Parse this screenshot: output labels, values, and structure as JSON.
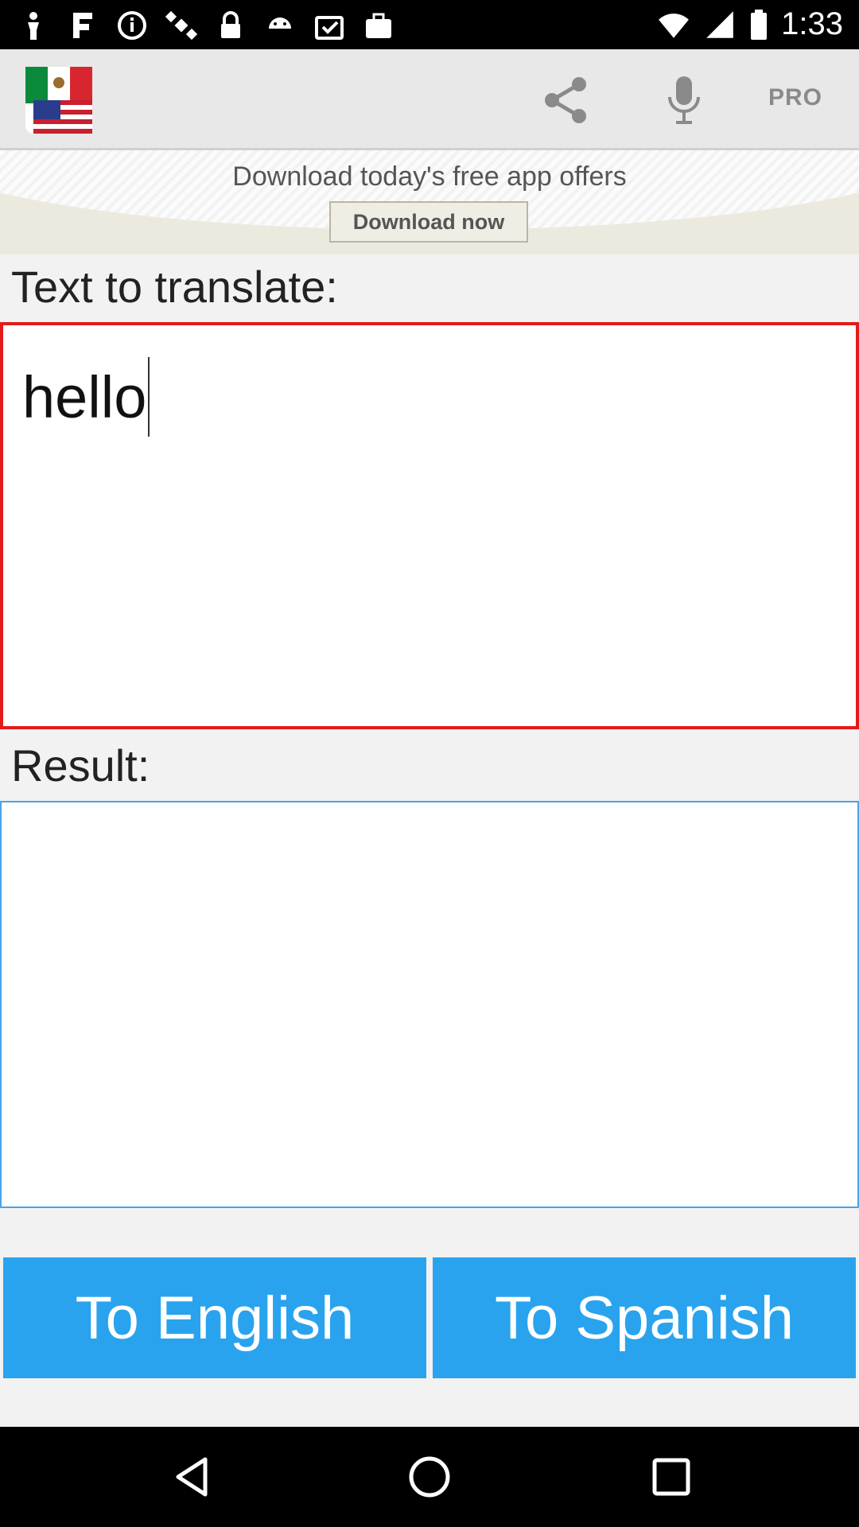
{
  "status_bar": {
    "time": "1:33",
    "icons": [
      "person-icon",
      "fake-gps-icon",
      "info-icon",
      "satellite-icon",
      "lock-icon",
      "android-icon",
      "clipboard-check-icon",
      "briefcase-icon"
    ]
  },
  "app_bar": {
    "flag_icon": "mexico-usa-flag-icon",
    "share_icon": "share-icon",
    "mic_icon": "microphone-icon",
    "pro_label": "PRO"
  },
  "ad": {
    "title": "Download today's free app offers",
    "button_label": "Download now"
  },
  "input_section": {
    "label": "Text to translate:",
    "value": "hello",
    "border_color": "#e41b1b"
  },
  "result_section": {
    "label": "Result:",
    "value": "",
    "border_color": "#4aa3e8"
  },
  "buttons": {
    "to_english": "To English",
    "to_spanish": "To Spanish",
    "color": "#29a3ee"
  },
  "nav_bar": {
    "icons": [
      "back-icon",
      "home-icon",
      "recents-icon"
    ]
  }
}
